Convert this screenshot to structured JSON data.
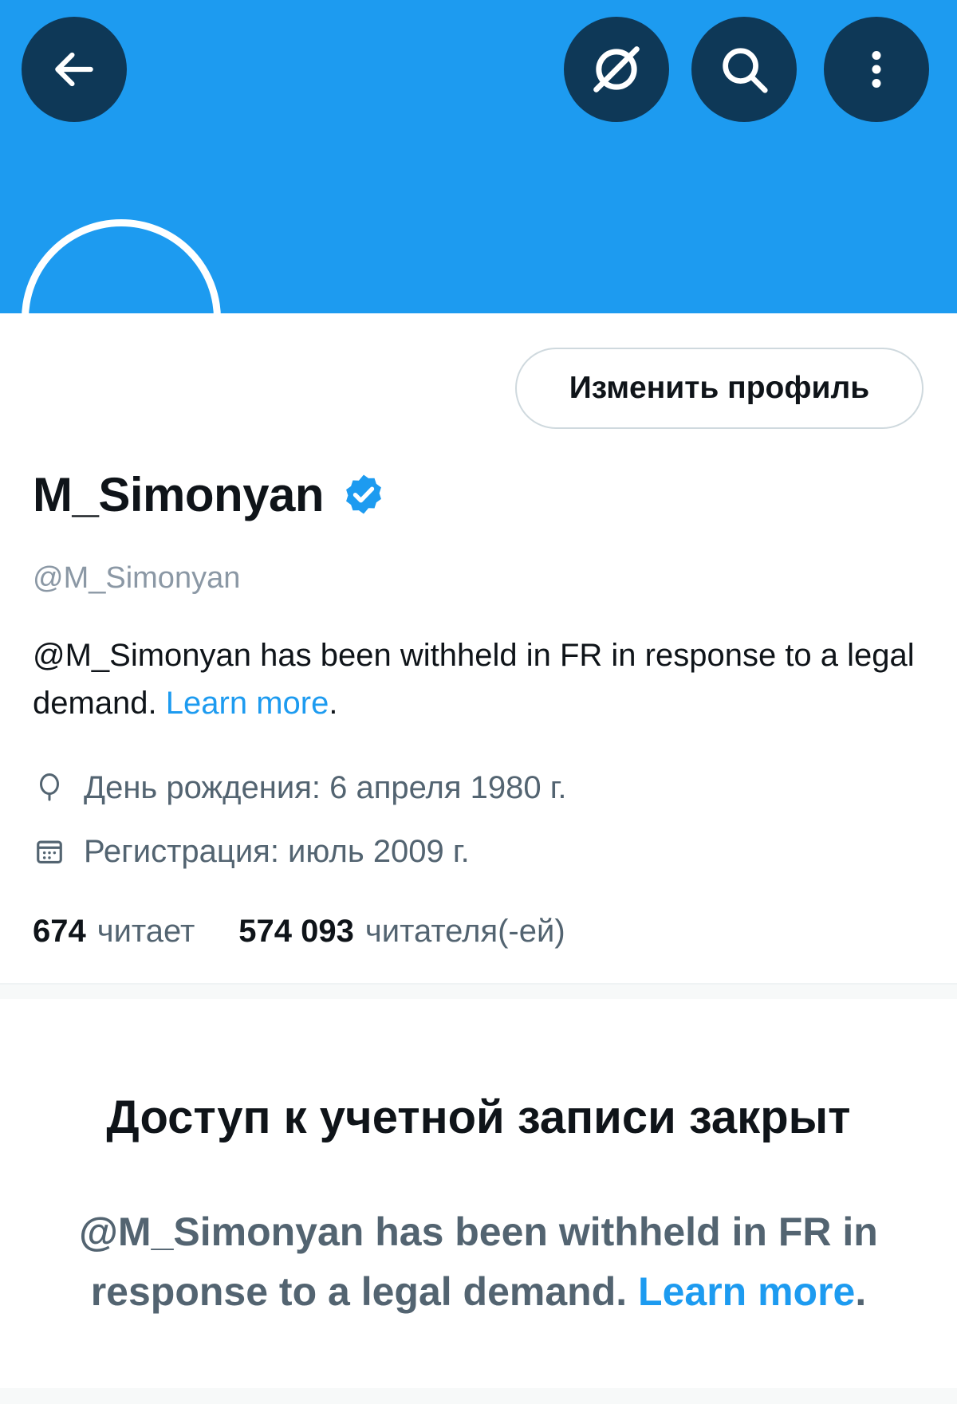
{
  "header": {
    "back_icon": "arrow-left-icon",
    "actions": [
      "no-location-icon",
      "search-icon",
      "more-vertical-icon"
    ]
  },
  "profile": {
    "edit_button": "Изменить профиль",
    "display_name": "M_Simonyan",
    "verified_icon": "verified-badge-icon",
    "handle": "@M_Simonyan",
    "bio_text": "@M_Simonyan has been withheld in FR in response to a legal demand. ",
    "bio_link": "Learn more",
    "bio_end": ".",
    "birthday": "День рождения: 6 апреля 1980 г.",
    "joined": "Регистрация: июль 2009 г.",
    "following_count": "674",
    "following_label": "читает",
    "followers_count": "574 093",
    "followers_label": "читателя(-ей)"
  },
  "withheld": {
    "title": "Доступ к учетной записи закрыт",
    "text": "@M_Simonyan has been withheld in FR in response to a legal demand. ",
    "link": "Learn more",
    "end": "."
  },
  "colors": {
    "banner": "#1d9bf0",
    "button_bg": "#0e3857",
    "link": "#1d9bf0",
    "secondary_text": "#536471"
  }
}
